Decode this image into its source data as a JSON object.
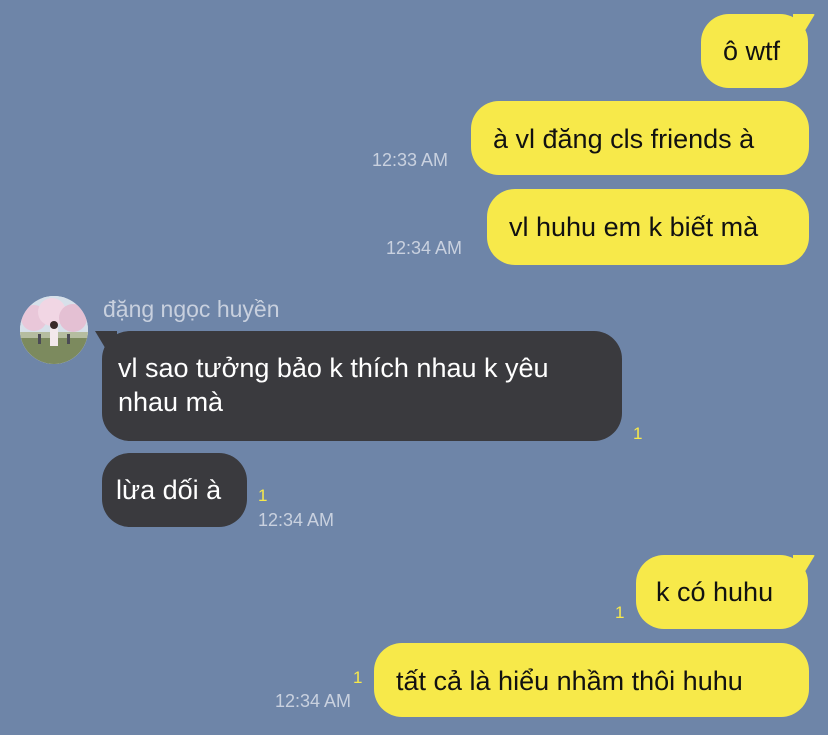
{
  "contact": {
    "name": "đặng ngọc huyền"
  },
  "messages": [
    {
      "text": "ô wtf",
      "direction": "outgoing"
    },
    {
      "text": "à vl đăng cls friends à",
      "direction": "outgoing",
      "time": "12:33 AM"
    },
    {
      "text": "vl huhu em k biết mà",
      "direction": "outgoing",
      "time": "12:34 AM"
    },
    {
      "text": "vl sao tưởng bảo k thích nhau k yêu nhau mà",
      "direction": "incoming",
      "unread": "1"
    },
    {
      "text": "lừa dối à",
      "direction": "incoming",
      "unread": "1",
      "time": "12:34 AM"
    },
    {
      "text": "k có huhu",
      "direction": "outgoing",
      "unread": "1"
    },
    {
      "text": "tất cả là hiểu nhầm thôi huhu",
      "direction": "outgoing",
      "unread": "1",
      "time": "12:34 AM"
    }
  ],
  "colors": {
    "background": "#6e85a8",
    "outgoing_bubble": "#f7e94a",
    "incoming_bubble": "#3a3a3e",
    "timestamp": "#c9d1df",
    "unread_marker": "#f7e94a"
  }
}
